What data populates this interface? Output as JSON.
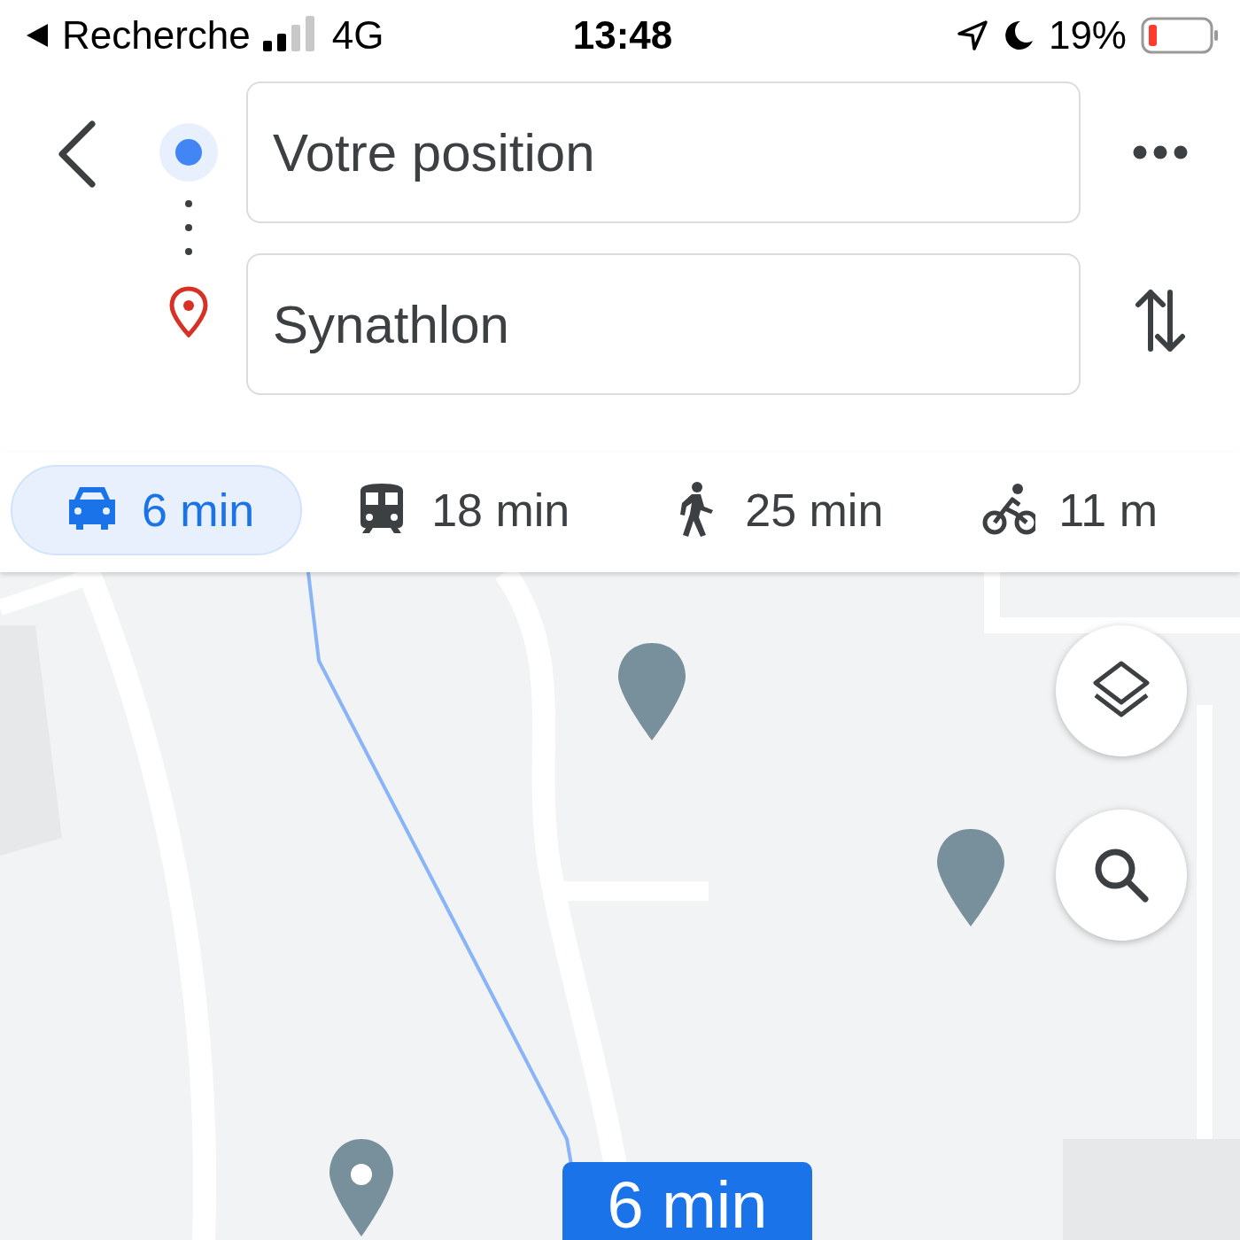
{
  "status_bar": {
    "back_label": "Recherche",
    "network": "4G",
    "time": "13:48",
    "battery": "19%"
  },
  "route": {
    "origin": {
      "value": "Votre position"
    },
    "destination": {
      "value": "Synathlon"
    }
  },
  "modes": [
    {
      "kind": "car",
      "duration": "6 min",
      "selected": true
    },
    {
      "kind": "transit",
      "duration": "18 min",
      "selected": false
    },
    {
      "kind": "walk",
      "duration": "25 min",
      "selected": false
    },
    {
      "kind": "bike",
      "duration": "11 m",
      "selected": false
    }
  ],
  "map": {
    "kind": "picture",
    "route_badge": "6 min"
  }
}
